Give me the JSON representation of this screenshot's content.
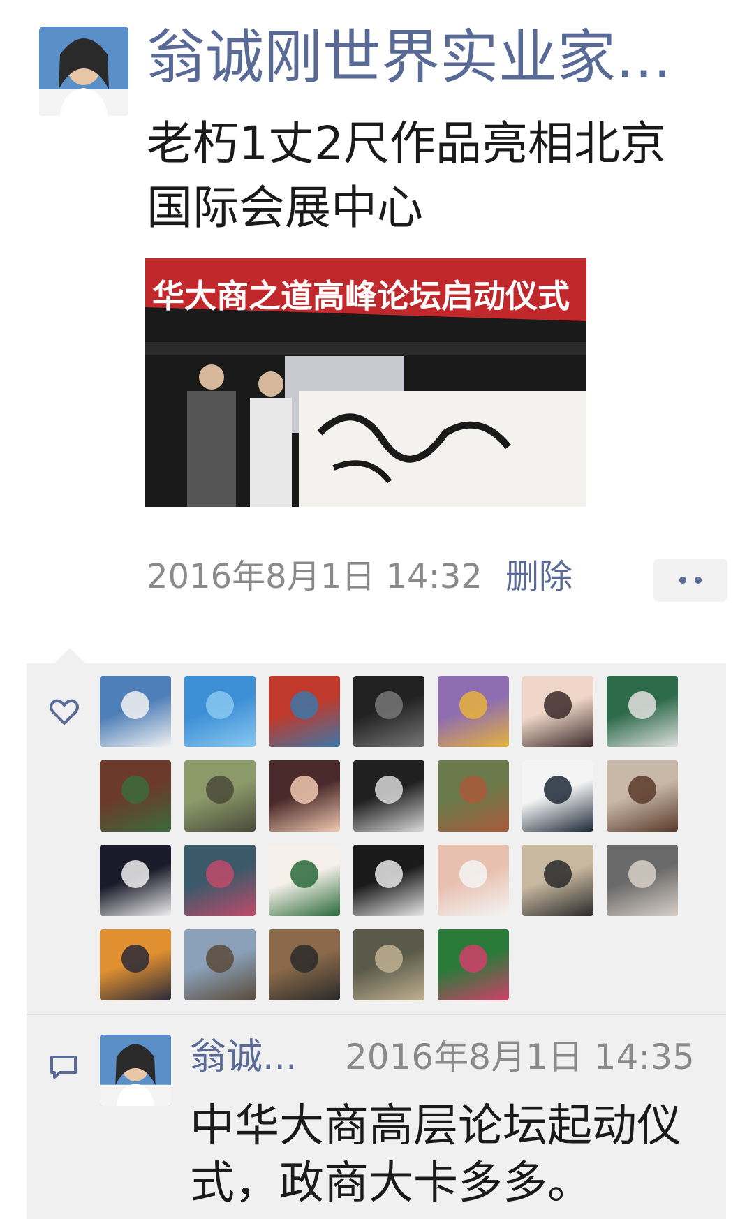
{
  "post": {
    "author": "翁诚刚世界实业家...",
    "text": "老朽1丈2尺作品亮相北京国际会展中心",
    "photo": {
      "banner_text": "华大商之道高峰论坛启动仪式"
    },
    "time": "2016年8月1日 14:32",
    "delete_label": "删除"
  },
  "icons": {
    "more": "more-dots-icon",
    "like": "heart-icon",
    "comment": "comment-icon"
  },
  "likes": {
    "avatars": [
      {
        "c1": "#4f7fb8",
        "c2": "#f2f2f2"
      },
      {
        "c1": "#3d8fd6",
        "c2": "#88c8f0"
      },
      {
        "c1": "#c0392b",
        "c2": "#3c78a8"
      },
      {
        "c1": "#222222",
        "c2": "#777777"
      },
      {
        "c1": "#8e6db1",
        "c2": "#e6b23c"
      },
      {
        "c1": "#f0d6c8",
        "c2": "#3a2a2a"
      },
      {
        "c1": "#2e6b4a",
        "c2": "#e0e0e0"
      },
      {
        "c1": "#6b3a2a",
        "c2": "#3c6b3c"
      },
      {
        "c1": "#8c9a6a",
        "c2": "#4a4a3a"
      },
      {
        "c1": "#4a2a2a",
        "c2": "#f0c8b0"
      },
      {
        "c1": "#202020",
        "c2": "#d8d8d8"
      },
      {
        "c1": "#6a7a4a",
        "c2": "#a85a3a"
      },
      {
        "c1": "#f4f4f4",
        "c2": "#1e2a3a"
      },
      {
        "c1": "#c8b8a8",
        "c2": "#5a3a2a"
      },
      {
        "c1": "#1a1a2a",
        "c2": "#f0f0f0"
      },
      {
        "c1": "#3a5a6a",
        "c2": "#c04a6a"
      },
      {
        "c1": "#f6f0ea",
        "c2": "#2a6a3a"
      },
      {
        "c1": "#1a1a1a",
        "c2": "#e8e8e8"
      },
      {
        "c1": "#e8c0b0",
        "c2": "#f4f4f4"
      },
      {
        "c1": "#c8b8a0",
        "c2": "#2a2a2a"
      },
      {
        "c1": "#6a6a6a",
        "c2": "#d8d0c8"
      },
      {
        "c1": "#e09030",
        "c2": "#2a2a3a"
      },
      {
        "c1": "#8aa0b8",
        "c2": "#5a4a3a"
      },
      {
        "c1": "#8a6a4a",
        "c2": "#2a2a2a"
      },
      {
        "c1": "#5a5a4a",
        "c2": "#c0b090"
      },
      {
        "c1": "#2a7a3a",
        "c2": "#d0406a"
      }
    ]
  },
  "comment": {
    "author": "翁诚...",
    "time": "2016年8月1日 14:35",
    "text": "中华大商高层论坛起动仪式，政商大卡多多。"
  }
}
